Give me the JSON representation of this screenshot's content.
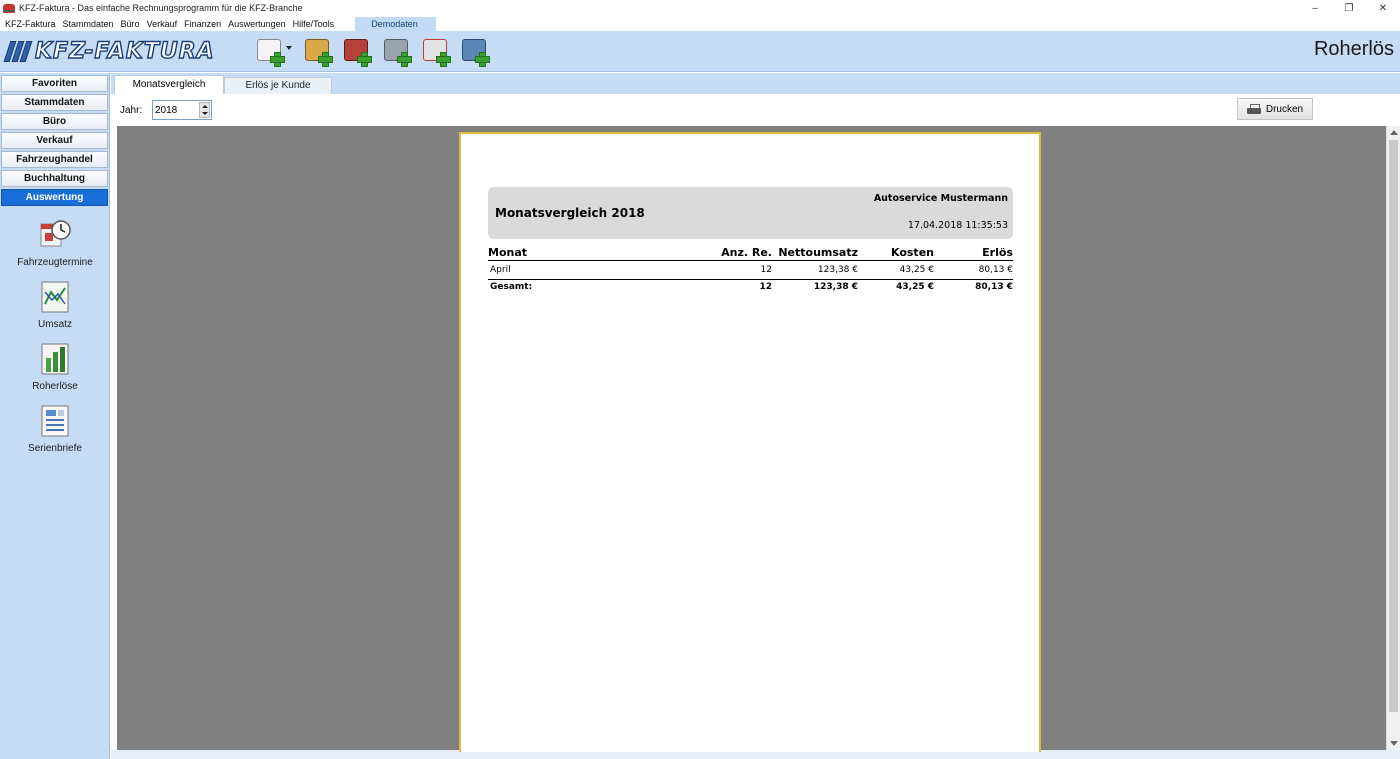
{
  "window": {
    "title": "KFZ-Faktura - Das einfache Rechnungsprogramm für die KFZ-Branche",
    "controls": {
      "minimize": "–",
      "restore": "❐",
      "close": "✕"
    }
  },
  "menu": {
    "items": [
      "KFZ-Faktura",
      "Stammdaten",
      "Büro",
      "Verkauf",
      "Finanzen",
      "Auswertungen",
      "Hilfe/Tools"
    ],
    "demo": "Demodaten"
  },
  "toolbar": {
    "logo_text": "KFZ-FAKTURA",
    "buttons": [
      "new-document-icon",
      "add-customer-icon",
      "add-vehicle-icon",
      "add-service-icon",
      "add-part-icon",
      "add-delivery-icon"
    ]
  },
  "header": {
    "title": "Roherlös"
  },
  "sidebar": {
    "sections": [
      "Favoriten",
      "Stammdaten",
      "Büro",
      "Verkauf",
      "Fahrzeughandel",
      "Buchhaltung",
      "Auswertung"
    ],
    "active_section": "Auswertung",
    "items": [
      {
        "label": "Fahrzeugtermine",
        "icon": "calendar-clock-icon"
      },
      {
        "label": "Umsatz",
        "icon": "line-chart-icon"
      },
      {
        "label": "Roherlöse",
        "icon": "bar-chart-icon"
      },
      {
        "label": "Serienbriefe",
        "icon": "letter-icon"
      }
    ]
  },
  "tabs": [
    {
      "label": "Monatsvergleich",
      "active": true
    },
    {
      "label": "Erlös je Kunde",
      "active": false
    }
  ],
  "filter": {
    "year_label": "Jahr:",
    "year_value": "2018"
  },
  "print_button": {
    "label": "Drucken"
  },
  "report": {
    "title": "Monatsvergleich 2018",
    "company": "Autoservice Mustermann",
    "datetime": "17.04.2018 11:35:53",
    "columns": [
      "Monat",
      "Anz. Re.",
      "Nettoumsatz",
      "Kosten",
      "Erlös"
    ],
    "rows": [
      {
        "monat": "April",
        "anzahl": "12",
        "netto": "123,38 €",
        "kosten": "43,25 €",
        "erloes": "80,13 €"
      }
    ],
    "total": {
      "label": "Gesamt:",
      "anzahl": "12",
      "netto": "123,38 €",
      "kosten": "43,25 €",
      "erloes": "80,13 €"
    }
  }
}
